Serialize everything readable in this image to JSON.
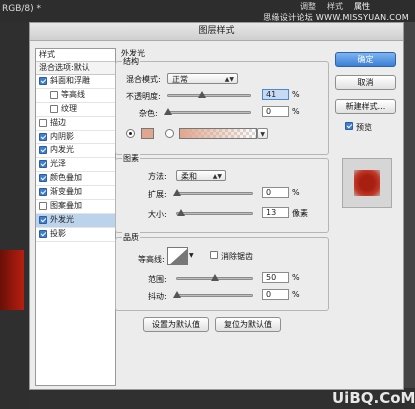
{
  "background": {
    "window_title": "RGB/8) *",
    "tabs": [
      "调整",
      "样式",
      "属性"
    ],
    "watermark": "思缘设计论坛 WWW.MISSYUAN.COM",
    "bottom_logo": "UiBQ.CoM"
  },
  "dialog": {
    "title": "图层样式",
    "sidebar": {
      "header": "样式",
      "blend_options": "混合选项:默认",
      "items": [
        {
          "label": "斜面和浮雕",
          "checked": true,
          "indent": false
        },
        {
          "label": "等高线",
          "checked": false,
          "indent": true
        },
        {
          "label": "纹理",
          "checked": false,
          "indent": true
        },
        {
          "label": "描边",
          "checked": false,
          "indent": false
        },
        {
          "label": "内阴影",
          "checked": true,
          "indent": false
        },
        {
          "label": "内发光",
          "checked": true,
          "indent": false
        },
        {
          "label": "光泽",
          "checked": true,
          "indent": false
        },
        {
          "label": "颜色叠加",
          "checked": true,
          "indent": false
        },
        {
          "label": "渐变叠加",
          "checked": true,
          "indent": false
        },
        {
          "label": "图案叠加",
          "checked": false,
          "indent": false
        },
        {
          "label": "外发光",
          "checked": true,
          "indent": false,
          "selected": true
        },
        {
          "label": "投影",
          "checked": true,
          "indent": false
        }
      ]
    },
    "panel": {
      "title": "外发光",
      "structure": {
        "legend": "结构",
        "blend_mode_label": "混合模式:",
        "blend_mode_value": "正常",
        "opacity_label": "不透明度:",
        "opacity_value": "41",
        "opacity_unit": "%",
        "opacity_fraction": 0.41,
        "noise_label": "杂色:",
        "noise_value": "0",
        "noise_unit": "%",
        "noise_fraction": 0.0,
        "color": "#e0a78e"
      },
      "elements": {
        "legend": "图素",
        "technique_label": "方法:",
        "technique_value": "柔和",
        "spread_label": "扩展:",
        "spread_value": "0",
        "spread_unit": "%",
        "spread_fraction": 0.0,
        "size_label": "大小:",
        "size_value": "13",
        "size_unit": "像素",
        "size_fraction": 0.052
      },
      "quality": {
        "legend": "品质",
        "contour_label": "等高线:",
        "antialias_label": "消除锯齿",
        "antialias_checked": false,
        "range_label": "范围:",
        "range_value": "50",
        "range_unit": "%",
        "range_fraction": 0.5,
        "jitter_label": "抖动:",
        "jitter_value": "0",
        "jitter_unit": "%",
        "jitter_fraction": 0.0
      },
      "set_default": "设置为默认值",
      "reset_default": "复位为默认值"
    },
    "buttons": {
      "ok": "确定",
      "cancel": "取消",
      "new_style": "新建样式...",
      "preview_label": "预览",
      "preview_checked": true
    },
    "colors": {
      "accent": "#3b7fd6",
      "selected_row": "#bcd3ec"
    }
  }
}
